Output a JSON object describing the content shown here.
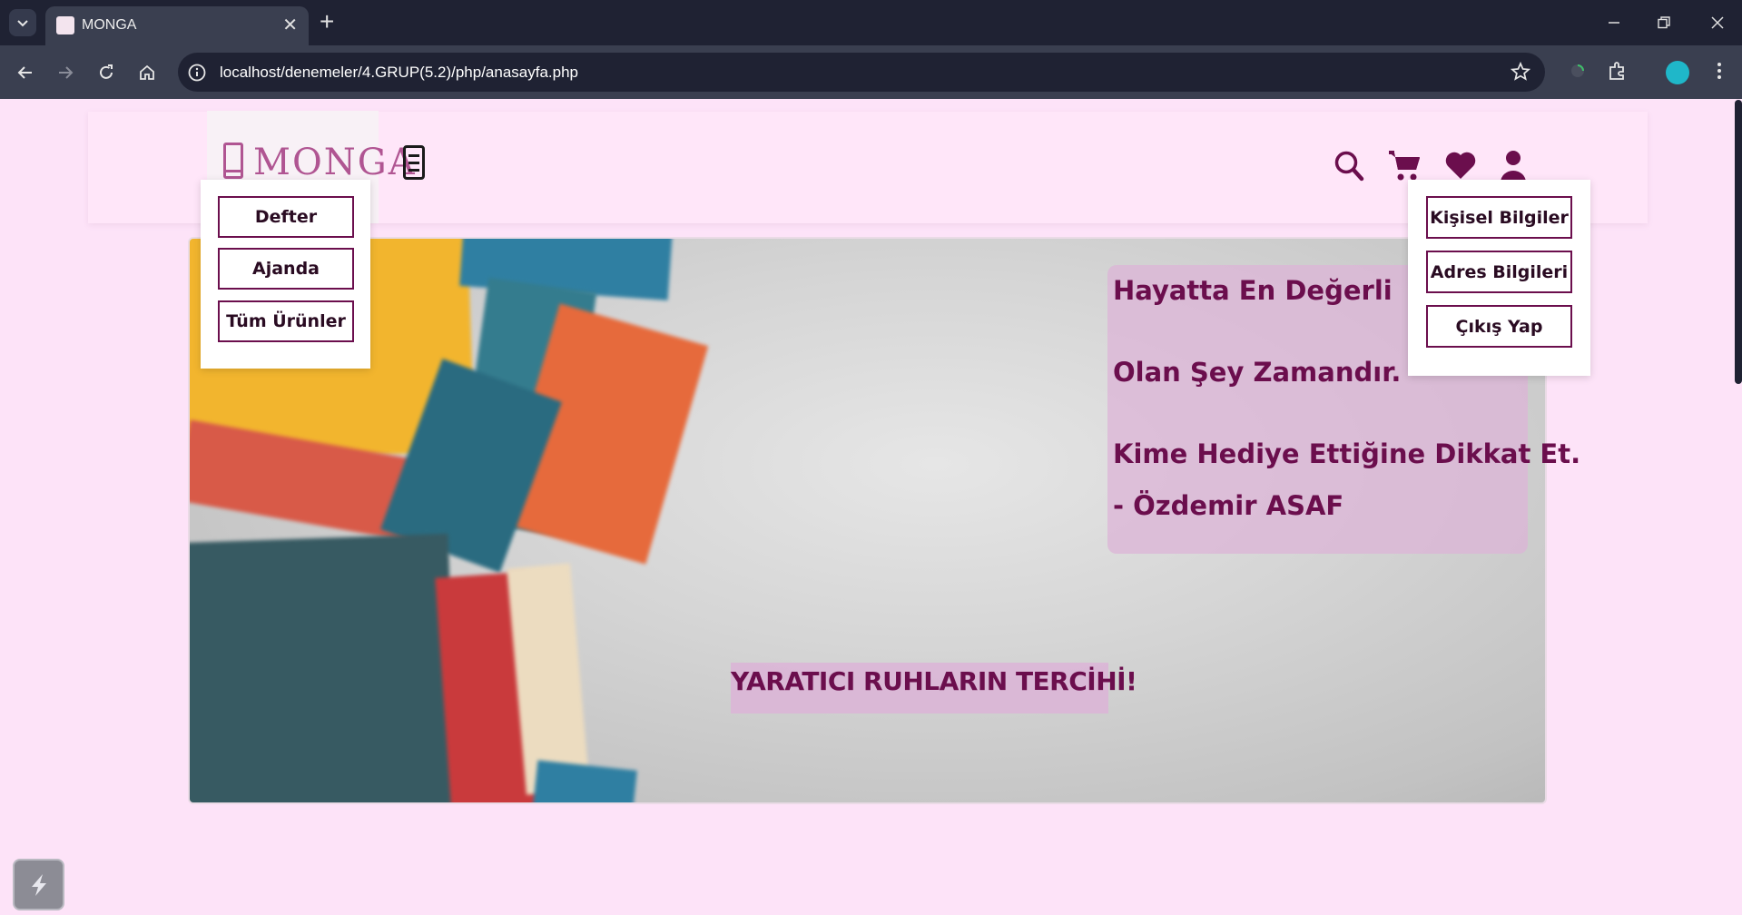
{
  "browser": {
    "tab": {
      "title": "MONGA"
    },
    "url": "localhost/denemeler/4.GRUP(5.2)/php/anasayfa.php"
  },
  "site": {
    "logo": "MONGA",
    "header_icons": [
      "search-icon",
      "cart-icon",
      "heart-icon",
      "user-icon"
    ],
    "category_menu": [
      "Defter",
      "Ajanda",
      "Tüm Ürünler"
    ],
    "user_menu": [
      "Kişisel Bilgiler",
      "Adres Bilgileri",
      "Çıkış Yap"
    ],
    "quote": {
      "line1": "Hayatta En Değerli",
      "line2": "Olan Şey Zamandır.",
      "line3": "Kime Hediye Ettiğine Dikkat Et.",
      "line4": "- Özdemir ASAF"
    },
    "slogan": "YARATICI RUHLARIN TERCİHİ!"
  },
  "colors": {
    "page_bg": "#fde3f8",
    "accent": "#6b0e4d",
    "logo": "#b05592"
  }
}
